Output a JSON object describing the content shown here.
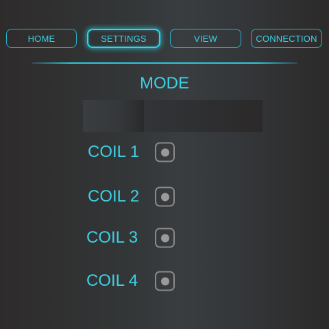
{
  "nav": {
    "home_label": "HOME",
    "settings_label": "SETTINGS",
    "view_label": "VIEW",
    "connection_label": "CONNECTION",
    "active_tab": "SETTINGS"
  },
  "main": {
    "mode_title": "MODE",
    "coils": [
      {
        "label": "COIL 1",
        "toggle_state": "off"
      },
      {
        "label": "COIL 2",
        "toggle_state": "off"
      },
      {
        "label": "COIL 3",
        "toggle_state": "off"
      },
      {
        "label": "COIL 4",
        "toggle_state": "off"
      }
    ]
  },
  "colors": {
    "accent": "#3cd0e6",
    "active_glow": "#2ad9f0",
    "toggle_border": "#8a8a8a",
    "toggle_dot": "#9a9a9a",
    "background": "#333637"
  }
}
